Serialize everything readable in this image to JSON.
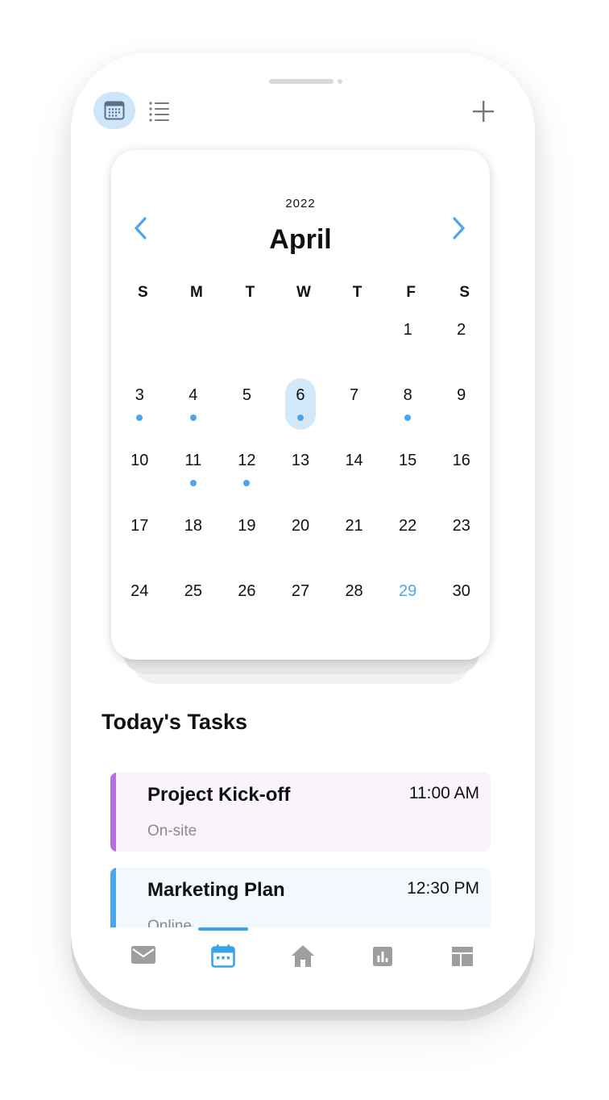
{
  "colors": {
    "accent": "#4ca6ee",
    "today_bg": "#d3e8f8",
    "text": "#111111",
    "muted": "#8a8a8a",
    "icon_gray": "#9e9e9e"
  },
  "topbar": {
    "calendar_view_icon": "calendar-icon",
    "list_view_icon": "list-icon",
    "add_icon": "plus-icon"
  },
  "calendar": {
    "year": "2022",
    "month": "April",
    "prev_icon": "chevron-left-icon",
    "next_icon": "chevron-right-icon",
    "weekdays": [
      "S",
      "M",
      "T",
      "W",
      "T",
      "F",
      "S"
    ],
    "leading_blanks": 5,
    "days": [
      {
        "n": "1",
        "dot": false
      },
      {
        "n": "2",
        "dot": false
      },
      {
        "n": "3",
        "dot": true
      },
      {
        "n": "4",
        "dot": true
      },
      {
        "n": "5",
        "dot": false
      },
      {
        "n": "6",
        "dot": true,
        "today": true
      },
      {
        "n": "7",
        "dot": false
      },
      {
        "n": "8",
        "dot": true
      },
      {
        "n": "9",
        "dot": false
      },
      {
        "n": "10",
        "dot": false
      },
      {
        "n": "11",
        "dot": true
      },
      {
        "n": "12",
        "dot": true
      },
      {
        "n": "13",
        "dot": false
      },
      {
        "n": "14",
        "dot": false
      },
      {
        "n": "15",
        "dot": false
      },
      {
        "n": "16",
        "dot": false
      },
      {
        "n": "17",
        "dot": false
      },
      {
        "n": "18",
        "dot": false
      },
      {
        "n": "19",
        "dot": false
      },
      {
        "n": "20",
        "dot": false
      },
      {
        "n": "21",
        "dot": false
      },
      {
        "n": "22",
        "dot": false
      },
      {
        "n": "23",
        "dot": false
      },
      {
        "n": "24",
        "dot": false
      },
      {
        "n": "25",
        "dot": false
      },
      {
        "n": "26",
        "dot": false
      },
      {
        "n": "27",
        "dot": false
      },
      {
        "n": "28",
        "dot": false
      },
      {
        "n": "29",
        "dot": false,
        "highlight": true
      },
      {
        "n": "30",
        "dot": false
      }
    ]
  },
  "tasks": {
    "heading": "Today's Tasks",
    "items": [
      {
        "title": "Project Kick-off",
        "time": "11:00 AM",
        "subtitle": "On-site",
        "accent": "#b46ee0",
        "bg": "#f9f4fc"
      },
      {
        "title": "Marketing Plan",
        "time": "12:30 PM",
        "subtitle": "Online",
        "accent": "#4ca6ee",
        "bg": "#f2f8fd"
      }
    ]
  },
  "bottom_nav": {
    "items": [
      {
        "icon": "mail-icon",
        "active": false
      },
      {
        "icon": "calendar-icon",
        "active": true
      },
      {
        "icon": "home-icon",
        "active": false
      },
      {
        "icon": "chart-icon",
        "active": false
      },
      {
        "icon": "dashboard-icon",
        "active": false
      }
    ]
  }
}
